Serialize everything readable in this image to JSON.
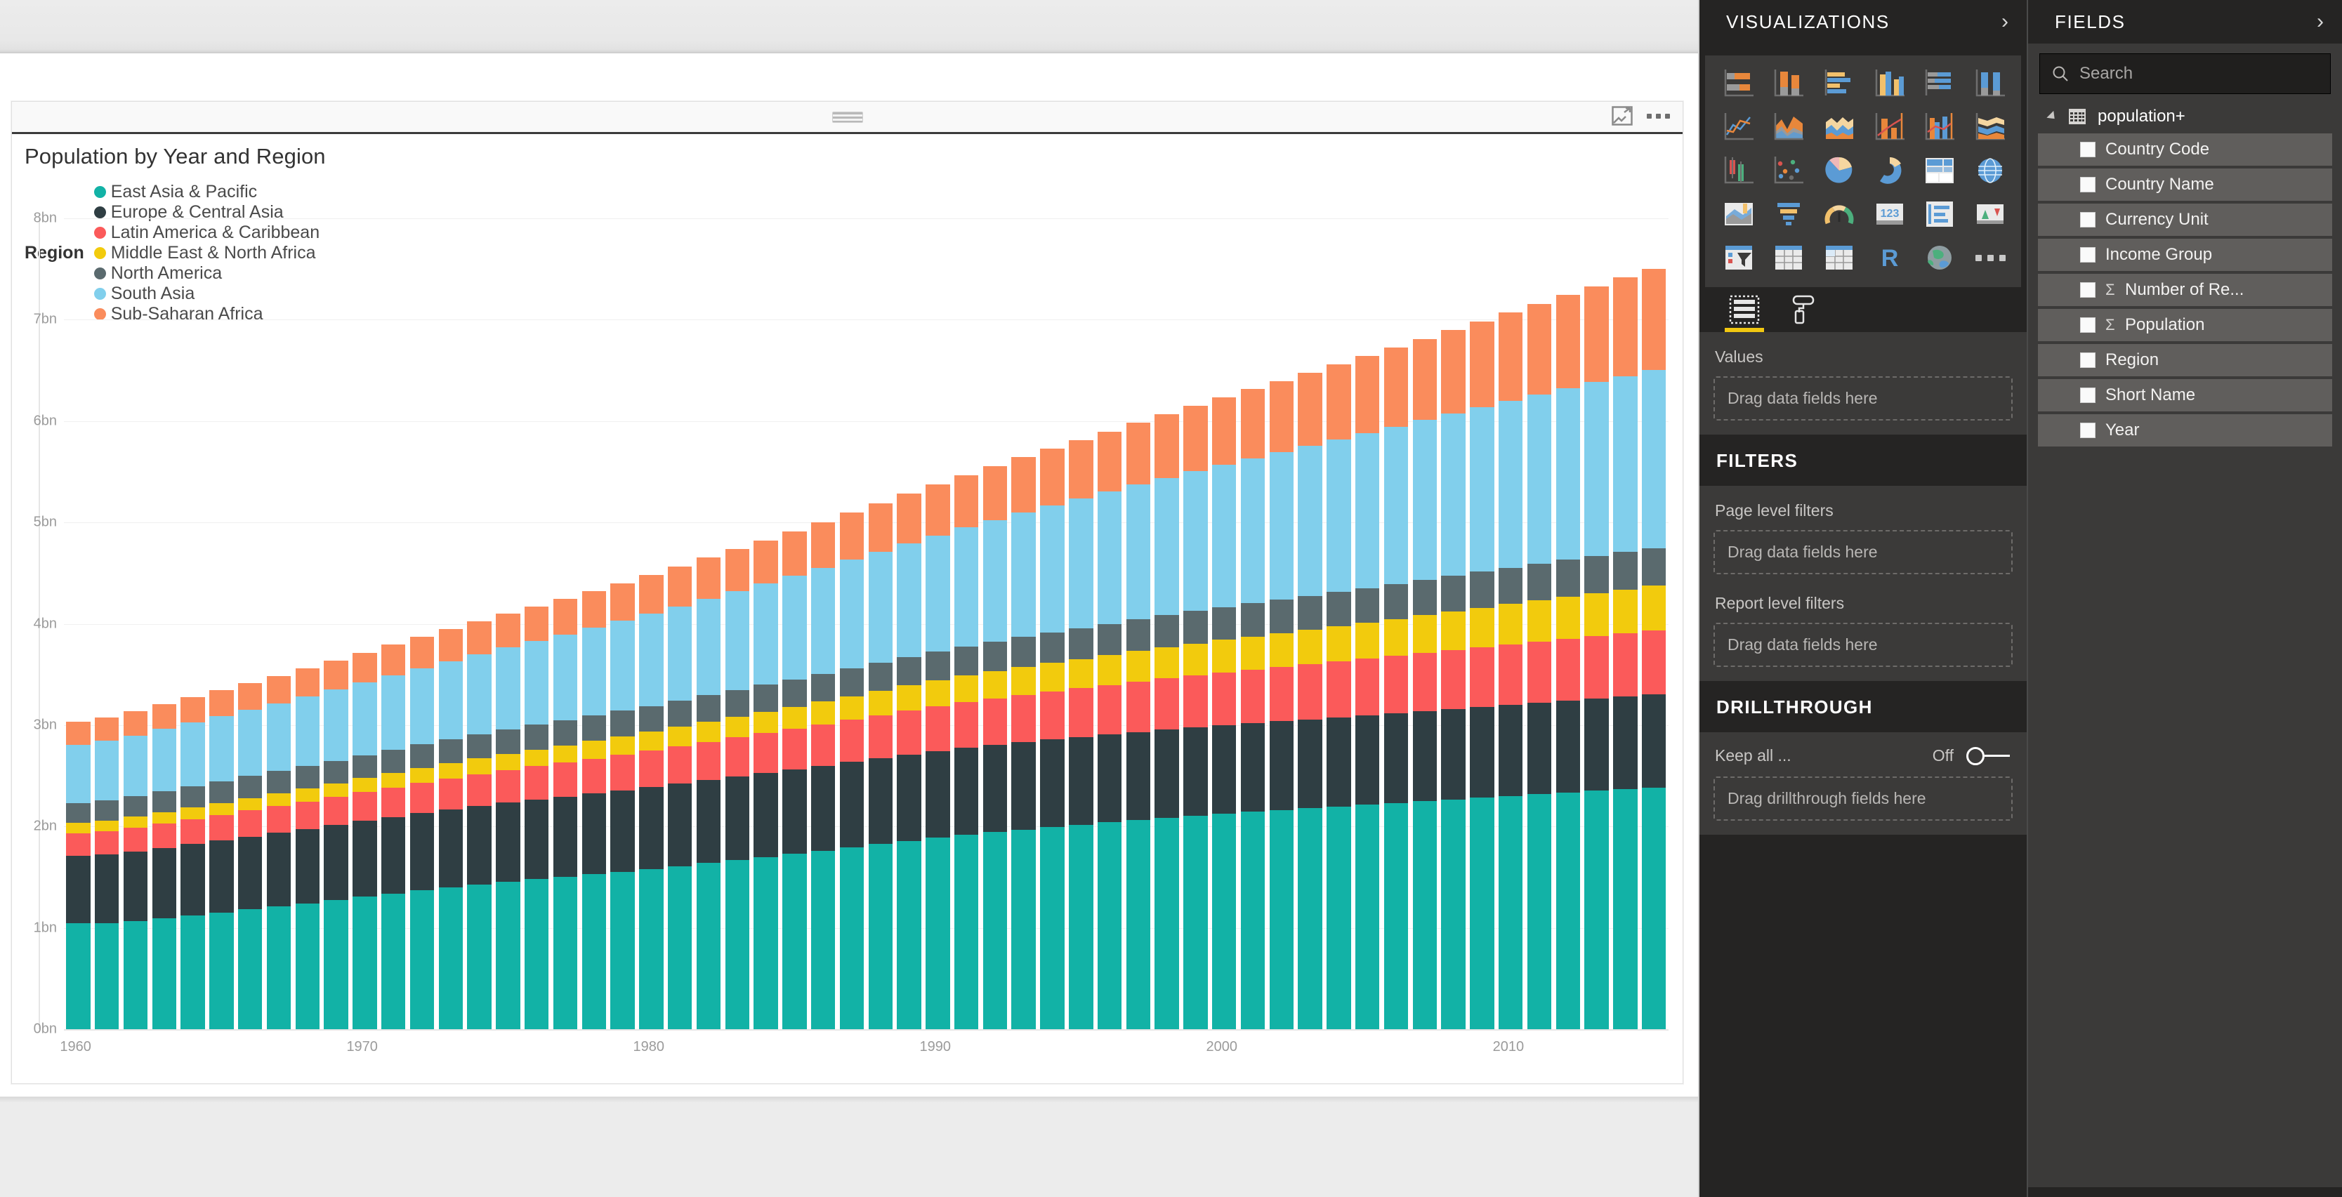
{
  "visual": {
    "title": "Population by Year and Region",
    "focus_icon": "focus-mode-icon",
    "more_icon": "more-options-icon",
    "drag_handle": "drag-handle"
  },
  "legend": {
    "title": "Region",
    "items": [
      {
        "label": "East Asia & Pacific",
        "color": "#12b2a6"
      },
      {
        "label": "Europe & Central Asia",
        "color": "#2f3e43"
      },
      {
        "label": "Latin America & Caribbean",
        "color": "#fb5a5a"
      },
      {
        "label": "Middle East & North Africa",
        "color": "#f2cb0d"
      },
      {
        "label": "North America",
        "color": "#5a6a6e"
      },
      {
        "label": "South Asia",
        "color": "#81cfec"
      },
      {
        "label": "Sub-Saharan Africa",
        "color": "#fa8c5c"
      }
    ]
  },
  "chart_data": {
    "type": "bar",
    "stacked": true,
    "title": "Population by Year and Region",
    "xlabel": "",
    "ylabel": "",
    "ylim": [
      0,
      8
    ],
    "y_unit": "bn",
    "ytick_labels": [
      "0bn",
      "1bn",
      "2bn",
      "3bn",
      "4bn",
      "5bn",
      "6bn",
      "7bn",
      "8bn"
    ],
    "ytick_values": [
      0,
      1,
      2,
      3,
      4,
      5,
      6,
      7,
      8
    ],
    "xtick_labels": [
      "1960",
      "1970",
      "1980",
      "1990",
      "2000",
      "2010"
    ],
    "grid": true,
    "legend_position": "top",
    "x": [
      1960,
      1961,
      1962,
      1963,
      1964,
      1965,
      1966,
      1967,
      1968,
      1969,
      1970,
      1971,
      1972,
      1973,
      1974,
      1975,
      1976,
      1977,
      1978,
      1979,
      1980,
      1981,
      1982,
      1983,
      1984,
      1985,
      1986,
      1987,
      1988,
      1989,
      1990,
      1991,
      1992,
      1993,
      1994,
      1995,
      1996,
      1997,
      1998,
      1999,
      2000,
      2001,
      2002,
      2003,
      2004,
      2005,
      2006,
      2007,
      2008,
      2009,
      2010,
      2011,
      2012,
      2013,
      2014,
      2015
    ],
    "series": [
      {
        "name": "East Asia & Pacific",
        "color": "#12b2a6",
        "values": [
          1.043,
          1.049,
          1.068,
          1.096,
          1.124,
          1.152,
          1.182,
          1.212,
          1.243,
          1.275,
          1.308,
          1.34,
          1.371,
          1.4,
          1.429,
          1.456,
          1.48,
          1.504,
          1.529,
          1.555,
          1.581,
          1.61,
          1.642,
          1.672,
          1.7,
          1.729,
          1.76,
          1.793,
          1.826,
          1.858,
          1.888,
          1.917,
          1.943,
          1.968,
          1.992,
          2.016,
          2.04,
          2.063,
          2.086,
          2.107,
          2.127,
          2.146,
          2.164,
          2.181,
          2.198,
          2.215,
          2.233,
          2.25,
          2.268,
          2.285,
          2.302,
          2.319,
          2.336,
          2.352,
          2.368,
          2.384
        ]
      },
      {
        "name": "Europe & Central Asia",
        "color": "#2f3e43",
        "values": [
          0.667,
          0.676,
          0.685,
          0.694,
          0.702,
          0.71,
          0.718,
          0.725,
          0.732,
          0.739,
          0.746,
          0.753,
          0.76,
          0.767,
          0.774,
          0.78,
          0.786,
          0.792,
          0.797,
          0.803,
          0.808,
          0.813,
          0.818,
          0.823,
          0.828,
          0.833,
          0.838,
          0.843,
          0.848,
          0.853,
          0.857,
          0.86,
          0.862,
          0.864,
          0.866,
          0.867,
          0.868,
          0.869,
          0.87,
          0.871,
          0.872,
          0.873,
          0.875,
          0.877,
          0.879,
          0.882,
          0.885,
          0.889,
          0.893,
          0.897,
          0.901,
          0.905,
          0.909,
          0.913,
          0.917,
          0.921
        ]
      },
      {
        "name": "Latin America & Caribbean",
        "color": "#fb5a5a",
        "values": [
          0.22,
          0.226,
          0.232,
          0.238,
          0.245,
          0.251,
          0.258,
          0.264,
          0.271,
          0.278,
          0.285,
          0.292,
          0.299,
          0.306,
          0.314,
          0.321,
          0.329,
          0.336,
          0.344,
          0.352,
          0.36,
          0.368,
          0.376,
          0.384,
          0.392,
          0.4,
          0.408,
          0.416,
          0.424,
          0.433,
          0.441,
          0.449,
          0.457,
          0.465,
          0.473,
          0.481,
          0.489,
          0.497,
          0.505,
          0.513,
          0.521,
          0.528,
          0.536,
          0.543,
          0.551,
          0.558,
          0.566,
          0.573,
          0.58,
          0.588,
          0.595,
          0.602,
          0.609,
          0.616,
          0.623,
          0.63
        ]
      },
      {
        "name": "Middle East & North Africa",
        "color": "#f2cb0d",
        "values": [
          0.105,
          0.108,
          0.111,
          0.114,
          0.117,
          0.12,
          0.124,
          0.127,
          0.131,
          0.134,
          0.138,
          0.142,
          0.146,
          0.151,
          0.155,
          0.16,
          0.165,
          0.17,
          0.175,
          0.181,
          0.187,
          0.193,
          0.199,
          0.206,
          0.213,
          0.22,
          0.227,
          0.234,
          0.241,
          0.248,
          0.255,
          0.262,
          0.269,
          0.276,
          0.282,
          0.289,
          0.296,
          0.302,
          0.309,
          0.315,
          0.322,
          0.328,
          0.335,
          0.342,
          0.349,
          0.356,
          0.364,
          0.372,
          0.38,
          0.389,
          0.397,
          0.405,
          0.414,
          0.422,
          0.431,
          0.44
        ]
      },
      {
        "name": "North America",
        "color": "#5a6a6e",
        "values": [
          0.199,
          0.202,
          0.205,
          0.208,
          0.211,
          0.213,
          0.216,
          0.218,
          0.22,
          0.223,
          0.226,
          0.23,
          0.233,
          0.235,
          0.238,
          0.24,
          0.243,
          0.245,
          0.248,
          0.251,
          0.254,
          0.257,
          0.26,
          0.262,
          0.265,
          0.268,
          0.271,
          0.274,
          0.277,
          0.281,
          0.284,
          0.288,
          0.292,
          0.296,
          0.3,
          0.304,
          0.307,
          0.311,
          0.315,
          0.319,
          0.323,
          0.327,
          0.33,
          0.334,
          0.337,
          0.341,
          0.344,
          0.348,
          0.352,
          0.355,
          0.358,
          0.361,
          0.364,
          0.367,
          0.37,
          0.373
        ]
      },
      {
        "name": "South Asia",
        "color": "#81cfec",
        "values": [
          0.572,
          0.585,
          0.598,
          0.612,
          0.626,
          0.641,
          0.656,
          0.671,
          0.687,
          0.703,
          0.72,
          0.737,
          0.754,
          0.772,
          0.79,
          0.809,
          0.828,
          0.848,
          0.868,
          0.889,
          0.91,
          0.932,
          0.954,
          0.977,
          1.0,
          1.024,
          1.048,
          1.072,
          1.097,
          1.122,
          1.148,
          1.174,
          1.2,
          1.226,
          1.252,
          1.278,
          1.304,
          1.33,
          1.356,
          1.382,
          1.407,
          1.432,
          1.457,
          1.482,
          1.506,
          1.53,
          1.554,
          1.578,
          1.601,
          1.624,
          1.647,
          1.669,
          1.691,
          1.713,
          1.734,
          1.755
        ]
      },
      {
        "name": "Sub-Saharan Africa",
        "color": "#fa8c5c",
        "values": [
          0.228,
          0.233,
          0.239,
          0.245,
          0.251,
          0.257,
          0.263,
          0.27,
          0.277,
          0.284,
          0.292,
          0.299,
          0.307,
          0.315,
          0.324,
          0.333,
          0.342,
          0.351,
          0.361,
          0.371,
          0.381,
          0.392,
          0.403,
          0.414,
          0.426,
          0.438,
          0.45,
          0.463,
          0.476,
          0.49,
          0.504,
          0.518,
          0.532,
          0.547,
          0.562,
          0.578,
          0.594,
          0.61,
          0.627,
          0.644,
          0.662,
          0.68,
          0.699,
          0.718,
          0.738,
          0.759,
          0.78,
          0.802,
          0.824,
          0.847,
          0.871,
          0.896,
          0.921,
          0.947,
          0.974,
          1.001
        ]
      }
    ]
  },
  "visualizations_pane": {
    "header": "VISUALIZATIONS",
    "collapse_icon": "chevron-right-icon",
    "gallery": [
      "stacked-bar-chart-icon",
      "stacked-column-chart-icon",
      "clustered-bar-chart-icon",
      "clustered-column-chart-icon",
      "hundred-percent-stacked-bar-chart-icon",
      "hundred-percent-stacked-column-chart-icon",
      "line-chart-icon",
      "area-chart-icon",
      "stacked-area-chart-icon",
      "line-and-stacked-column-chart-icon",
      "line-and-clustered-column-chart-icon",
      "ribbon-chart-icon",
      "waterfall-chart-icon",
      "scatter-chart-icon",
      "pie-chart-icon",
      "donut-chart-icon",
      "treemap-icon",
      "map-icon",
      "filled-map-icon",
      "funnel-chart-icon",
      "gauge-chart-icon",
      "card-icon",
      "multi-row-card-icon",
      "kpi-icon",
      "slicer-icon",
      "table-icon",
      "matrix-icon",
      "r-script-visual-icon",
      "arcgis-map-icon",
      "more-visuals-icon"
    ],
    "tabs": [
      {
        "name": "fields-tab",
        "icon": "fields-pane-icon",
        "active": true
      },
      {
        "name": "format-tab",
        "icon": "paint-roller-icon",
        "active": false
      }
    ],
    "values_label": "Values",
    "values_dropzone": "Drag data fields here",
    "filters": {
      "title": "FILTERS",
      "page_level_label": "Page level filters",
      "page_level_dropzone": "Drag data fields here",
      "report_level_label": "Report level filters",
      "report_level_dropzone": "Drag data fields here"
    },
    "drillthrough": {
      "title": "DRILLTHROUGH",
      "keep_all_label": "Keep all ...",
      "toggle_state": "Off",
      "dropzone": "Drag drillthrough fields here"
    }
  },
  "fields_pane": {
    "header": "FIELDS",
    "collapse_icon": "chevron-right-icon",
    "search_placeholder": "Search",
    "search_icon": "search-icon",
    "table_name": "population+",
    "table_icon": "table-icon",
    "expand_icon": "triangle-expanded-icon",
    "fields": [
      {
        "name": "Country Code",
        "aggregate": false
      },
      {
        "name": "Country Name",
        "aggregate": false
      },
      {
        "name": "Currency Unit",
        "aggregate": false
      },
      {
        "name": "Income Group",
        "aggregate": false
      },
      {
        "name": "Number of Re...",
        "aggregate": true
      },
      {
        "name": "Population",
        "aggregate": true
      },
      {
        "name": "Region",
        "aggregate": false
      },
      {
        "name": "Short Name",
        "aggregate": false
      },
      {
        "name": "Year",
        "aggregate": false
      }
    ]
  },
  "colors": {
    "pane_bg": "#252423",
    "pane_section_bg": "#3b3a39",
    "accent": "#f2c811",
    "field_row_bg": "#605e5c"
  }
}
